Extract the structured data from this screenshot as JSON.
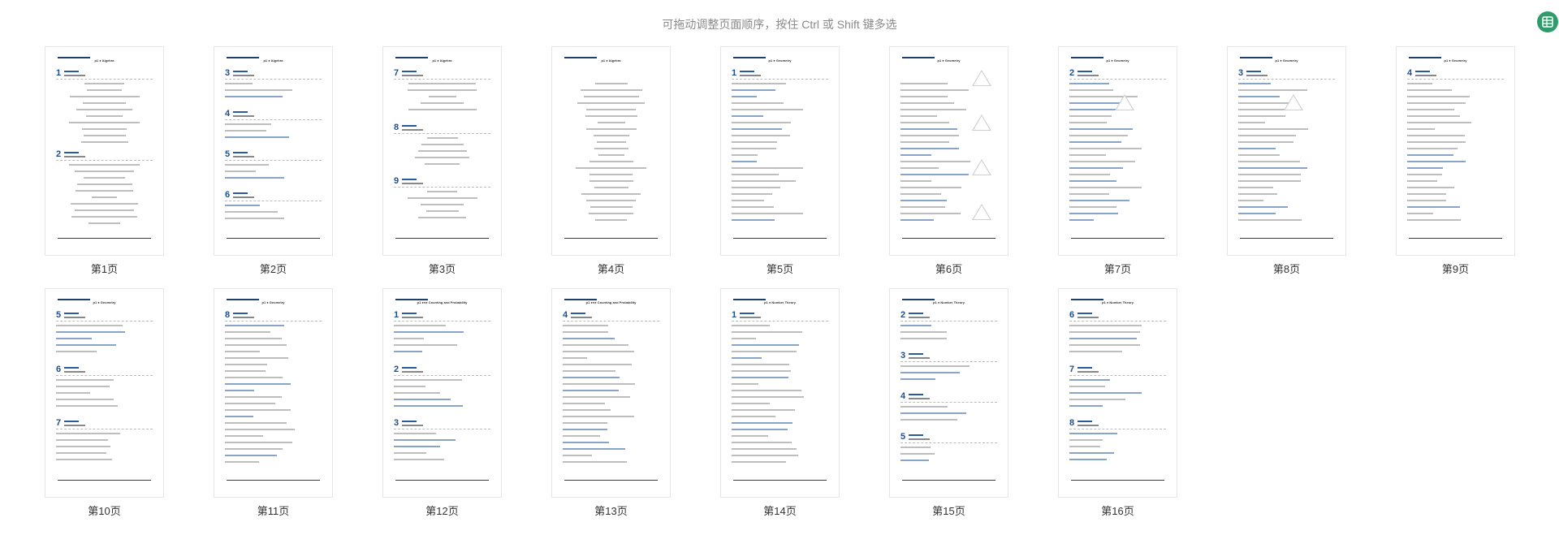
{
  "hint": "可拖动调整页面顺序，按住 Ctrl 或 Shift 键多选",
  "fab_icon": "spreadsheet-icon",
  "accent": "#2f9b6a",
  "pages": [
    {
      "label": "第1页",
      "title": "p1 ● Algebra",
      "sections": [
        "1",
        "2"
      ]
    },
    {
      "label": "第2页",
      "title": "p1 ● Algebra",
      "sections": [
        "3",
        "4",
        "5",
        "6"
      ]
    },
    {
      "label": "第3页",
      "title": "p1 ● Algebra",
      "sections": [
        "7",
        "8",
        "9"
      ]
    },
    {
      "label": "第4页",
      "title": "p1 ● Algebra",
      "sections": []
    },
    {
      "label": "第5页",
      "title": "p1 ● Geometry",
      "sections": [
        "1"
      ]
    },
    {
      "label": "第6页",
      "title": "p1 ● Geometry",
      "sections": []
    },
    {
      "label": "第7页",
      "title": "p1 ● Geometry",
      "sections": [
        "2"
      ]
    },
    {
      "label": "第8页",
      "title": "p1 ● Geometry",
      "sections": [
        "3"
      ]
    },
    {
      "label": "第9页",
      "title": "p1 ● Geometry",
      "sections": [
        "4"
      ]
    },
    {
      "label": "第10页",
      "title": "p1 ● Geometry",
      "sections": [
        "5",
        "6",
        "7"
      ]
    },
    {
      "label": "第11页",
      "title": "p1 ● Geometry",
      "sections": [
        "8"
      ]
    },
    {
      "label": "第12页",
      "title": "p1 ●●● Counting and Probability",
      "sections": [
        "1",
        "2",
        "3"
      ]
    },
    {
      "label": "第13页",
      "title": "p1 ●●● Counting and Probability",
      "sections": [
        "4"
      ]
    },
    {
      "label": "第14页",
      "title": "p1 ● Number Theory",
      "sections": [
        "1"
      ]
    },
    {
      "label": "第15页",
      "title": "p1 ● Number Theory",
      "sections": [
        "2",
        "3",
        "4",
        "5"
      ]
    },
    {
      "label": "第16页",
      "title": "p1 ● Number Theory",
      "sections": [
        "6",
        "7",
        "8"
      ]
    }
  ]
}
